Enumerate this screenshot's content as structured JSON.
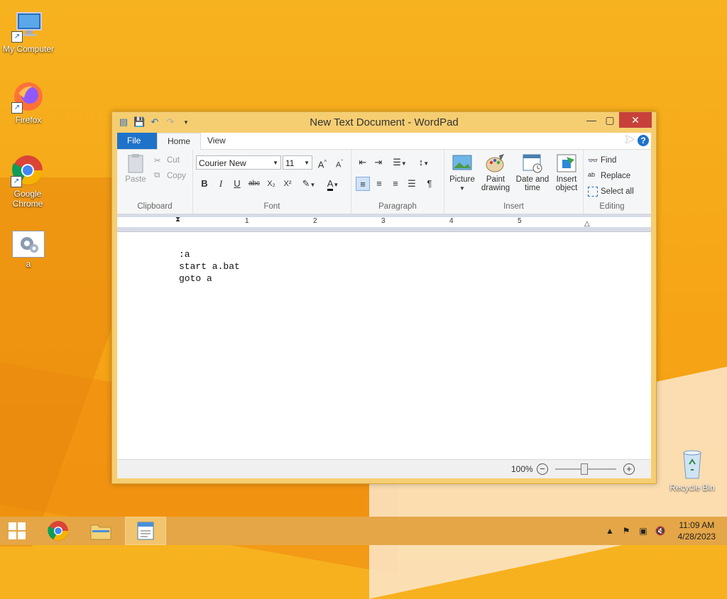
{
  "desktop": {
    "icons": [
      {
        "label": "My Computer"
      },
      {
        "label": "Firefox"
      },
      {
        "label": "Google Chrome"
      },
      {
        "label": "a"
      },
      {
        "label": "Recycle Bin"
      }
    ]
  },
  "window": {
    "title": "New Text Document - WordPad",
    "controls": {
      "minimize": "—",
      "maximize": "▢",
      "close": "✕"
    }
  },
  "tabs": {
    "file": "File",
    "home": "Home",
    "view": "View"
  },
  "ribbon": {
    "clipboard": {
      "label": "Clipboard",
      "paste": "Paste",
      "cut": "Cut",
      "copy": "Copy"
    },
    "font": {
      "label": "Font",
      "family": "Courier New",
      "size": "11",
      "bold": "B",
      "italic": "I",
      "underline": "U",
      "strike": "abc",
      "subscript": "X₂",
      "superscript": "X²"
    },
    "paragraph": {
      "label": "Paragraph"
    },
    "insert": {
      "label": "Insert",
      "picture": "Picture",
      "paint_line1": "Paint",
      "paint_line2": "drawing",
      "date_line1": "Date and",
      "date_line2": "time",
      "object_line1": "Insert",
      "object_line2": "object"
    },
    "editing": {
      "label": "Editing",
      "find": "Find",
      "replace": "Replace",
      "select_all": "Select all"
    }
  },
  "ruler": {
    "numbers": [
      "1",
      "2",
      "3",
      "4",
      "5"
    ]
  },
  "document": {
    "lines": [
      ":a",
      "start a.bat",
      "goto a"
    ]
  },
  "status": {
    "zoom_label": "100%",
    "zoom_level": 0.42
  },
  "taskbar": {
    "time": "11:09 AM",
    "date": "4/28/2023"
  },
  "colors": {
    "accent": "#1e73c9",
    "window_frame": "#f6ce72",
    "close": "#c7403a",
    "desktop": "#f7b21f"
  }
}
